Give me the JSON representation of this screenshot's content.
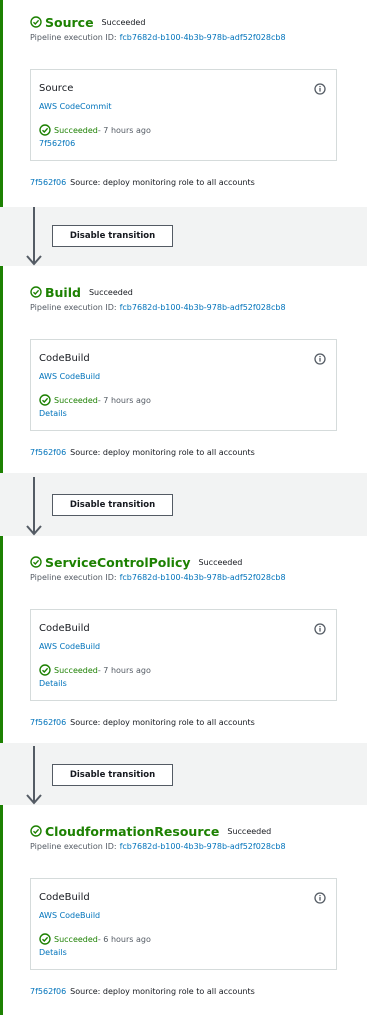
{
  "stages": [
    {
      "name": "Source",
      "status": "Succeeded",
      "exec_label": "Pipeline execution ID:",
      "exec_id": "fcb7682d-b100-4b3b-978b-adf52f028cb8",
      "action": {
        "name": "Source",
        "provider": "AWS CodeCommit",
        "status": "Succeeded",
        "time": " - 7 hours ago",
        "link": "7f562f06"
      },
      "commit_id": "7f562f06",
      "commit_msg": "Source: deploy monitoring role to all accounts"
    },
    {
      "name": "Build",
      "status": "Succeeded",
      "exec_label": "Pipeline execution ID:",
      "exec_id": "fcb7682d-b100-4b3b-978b-adf52f028cb8",
      "action": {
        "name": "CodeBuild",
        "provider": "AWS CodeBuild",
        "status": "Succeeded",
        "time": " - 7 hours ago",
        "link": "Details"
      },
      "commit_id": "7f562f06",
      "commit_msg": "Source: deploy monitoring role to all accounts"
    },
    {
      "name": "ServiceControlPolicy",
      "status": "Succeeded",
      "exec_label": "Pipeline execution ID:",
      "exec_id": "fcb7682d-b100-4b3b-978b-adf52f028cb8",
      "action": {
        "name": "CodeBuild",
        "provider": "AWS CodeBuild",
        "status": "Succeeded",
        "time": " - 7 hours ago",
        "link": "Details"
      },
      "commit_id": "7f562f06",
      "commit_msg": "Source: deploy monitoring role to all accounts"
    },
    {
      "name": "CloudformationResource",
      "status": "Succeeded",
      "exec_label": "Pipeline execution ID:",
      "exec_id": "fcb7682d-b100-4b3b-978b-adf52f028cb8",
      "action": {
        "name": "CodeBuild",
        "provider": "AWS CodeBuild",
        "status": "Succeeded",
        "time": " - 6 hours ago",
        "link": "Details"
      },
      "commit_id": "7f562f06",
      "commit_msg": "Source: deploy monitoring role to all accounts"
    }
  ],
  "transitions": [
    {
      "label": "Disable transition"
    },
    {
      "label": "Disable transition"
    },
    {
      "label": "Disable transition"
    }
  ],
  "colors": {
    "success": "#1d8102",
    "link": "#0073bb",
    "background": "#f2f3f3"
  },
  "icons": {
    "status": "success-check-circle-icon",
    "info": "info-circle-icon",
    "arrow": "down-arrow-icon"
  }
}
